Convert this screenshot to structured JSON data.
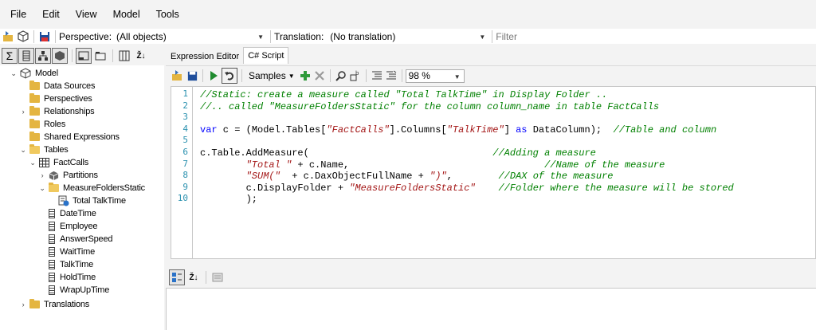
{
  "menu": [
    "File",
    "Edit",
    "View",
    "Model",
    "Tools"
  ],
  "toolbar": {
    "perspective_label": "Perspective:",
    "perspective_value": "(All objects)",
    "translation_label": "Translation:",
    "translation_value": "(No translation)",
    "filter_placeholder": "Filter"
  },
  "tabs": [
    {
      "label": "Expression Editor",
      "active": false
    },
    {
      "label": "C# Script",
      "active": true
    }
  ],
  "editor_toolbar": {
    "samples_label": "Samples",
    "zoom": "98 %"
  },
  "tree": {
    "model": "Model",
    "data_sources": "Data Sources",
    "perspectives": "Perspectives",
    "relationships": "Relationships",
    "roles": "Roles",
    "shared_expressions": "Shared Expressions",
    "tables": "Tables",
    "factcalls": "FactCalls",
    "partitions": "Partitions",
    "measure_folder": "MeasureFoldersStatic",
    "measure": "Total TalkTime",
    "columns": [
      "DateTime",
      "Employee",
      "AnswerSpeed",
      "WaitTime",
      "TalkTime",
      "HoldTime",
      "WrapUpTime"
    ],
    "translations": "Translations"
  },
  "code": {
    "l1": "//Static: create a measure called \"Total TalkTime\" in Display Folder ..",
    "l2": "//.. called \"MeasureFoldersStatic\" for the column column_name in table FactCalls",
    "l4_kw": "var",
    "l4_a": " c = (Model.Tables[",
    "l4_s1": "\"FactCalls\"",
    "l4_b": "].Columns[",
    "l4_s2": "\"TalkTime\"",
    "l4_c": "] ",
    "l4_kw2": "as",
    "l4_d": " DataColumn);  ",
    "l4_cm": "//Table and column",
    "l6_a": "c.Table.AddMeasure(                                ",
    "l6_cm": "//Adding a measure",
    "l7_ind": "        ",
    "l7_s": "\"Total \"",
    "l7_a": " + c.Name,                                  ",
    "l7_cm": "//Name of the measure",
    "l8_ind": "        ",
    "l8_s1": "\"SUM(\"",
    "l8_a": "  + c.DaxObjectFullName + ",
    "l8_s2": "\")\"",
    "l8_b": ",        ",
    "l8_cm": "//DAX of the measure",
    "l9_a": "        c.DisplayFolder + ",
    "l9_s": "\"MeasureFoldersStatic\"",
    "l9_b": "    ",
    "l9_cm": "//Folder where the measure will be stored",
    "l10": "        );",
    "line_numbers": [
      "1",
      "2",
      "3",
      "4",
      "5",
      "6",
      "7",
      "8",
      "9",
      "10"
    ]
  },
  "colors": {
    "comment": "#008000",
    "string": "#a31515",
    "keyword": "#0000ff",
    "line_number": "#2b91af"
  }
}
